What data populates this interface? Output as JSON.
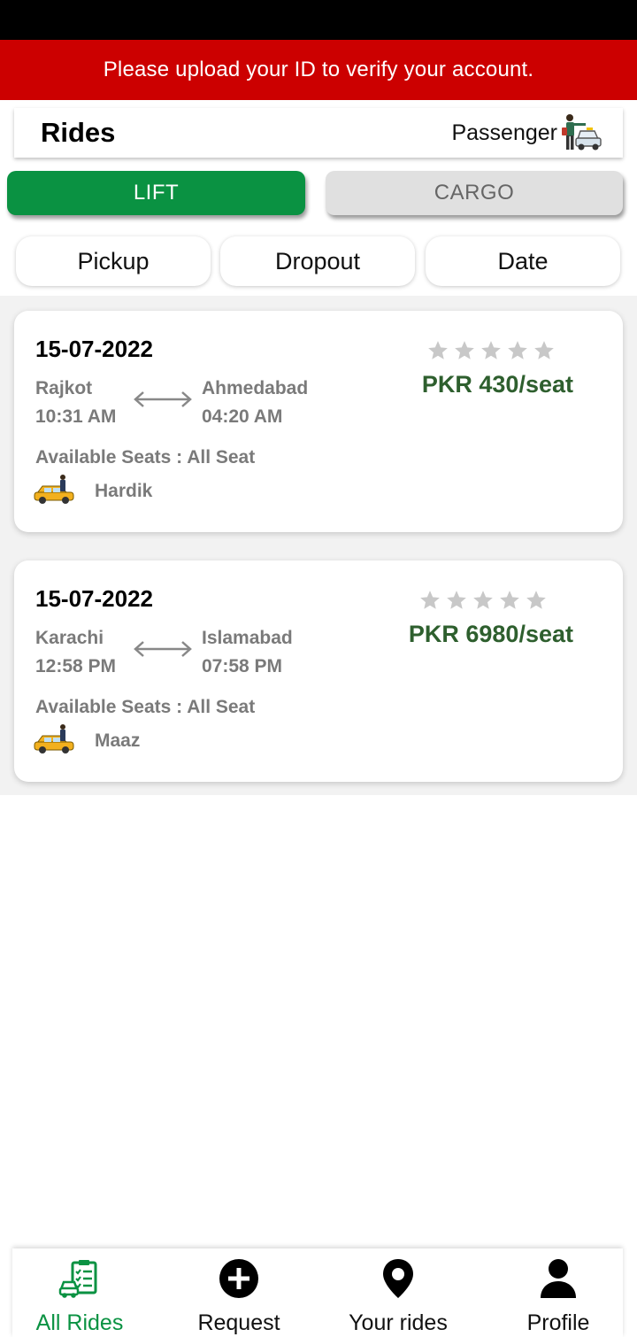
{
  "banner": {
    "text": "Please upload your ID to verify your account."
  },
  "header": {
    "title": "Rides",
    "role_label": "Passenger",
    "role_icon": "passenger-icon"
  },
  "modes": [
    {
      "label": "LIFT",
      "active": true
    },
    {
      "label": "CARGO",
      "active": false
    }
  ],
  "sort_options": [
    "Pickup",
    "Dropout",
    "Date"
  ],
  "rides": [
    {
      "date": "15-07-2022",
      "from_city": "Rajkot",
      "from_time": "10:31 AM",
      "to_city": "Ahmedabad",
      "to_time": "04:20 AM",
      "seats": "Available Seats : All Seat",
      "driver": "Hardik",
      "rating": 0,
      "price": "PKR 430/seat"
    },
    {
      "date": "15-07-2022",
      "from_city": "Karachi",
      "from_time": "12:58 PM",
      "to_city": "Islamabad",
      "to_time": "07:58 PM",
      "seats": "Available Seats : All Seat",
      "driver": "Maaz",
      "rating": 0,
      "price": "PKR 6980/seat"
    }
  ],
  "bottom_nav": [
    {
      "label": "All Rides",
      "icon": "car-checklist-icon",
      "active": true
    },
    {
      "label": "Request",
      "icon": "plus-circle-icon",
      "active": false
    },
    {
      "label": "Your rides",
      "icon": "location-pin-icon",
      "active": false
    },
    {
      "label": "Profile",
      "icon": "person-icon",
      "active": false
    }
  ],
  "colors": {
    "banner": "#cc0000",
    "primary": "#0a9242",
    "price": "#2e5f2e",
    "muted": "#7a7a7a",
    "star": "#c8c8c8"
  }
}
